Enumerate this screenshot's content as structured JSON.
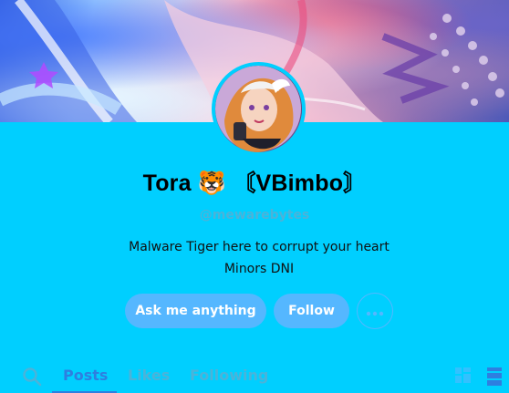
{
  "profile": {
    "title": "Tora 🐯 〘VBimbo〙",
    "handle": "@mewarebytes",
    "bio_line1": "Malware Tiger here to corrupt your heart",
    "bio_line2": "Minors DNI"
  },
  "actions": {
    "ask_label": "Ask me anything",
    "follow_label": "Follow",
    "more_icon": "ellipsis-icon"
  },
  "tabs": [
    {
      "label": "Posts",
      "active": true
    },
    {
      "label": "Likes",
      "active": false
    },
    {
      "label": "Following",
      "active": false
    }
  ],
  "icons": {
    "search": "search-icon",
    "grid_view": "grid-view-icon",
    "list_view": "list-view-icon"
  },
  "colors": {
    "background": "#00cfff",
    "button": "#55b7ff",
    "accent": "#2e7fe0",
    "muted": "#4bb3d9"
  }
}
